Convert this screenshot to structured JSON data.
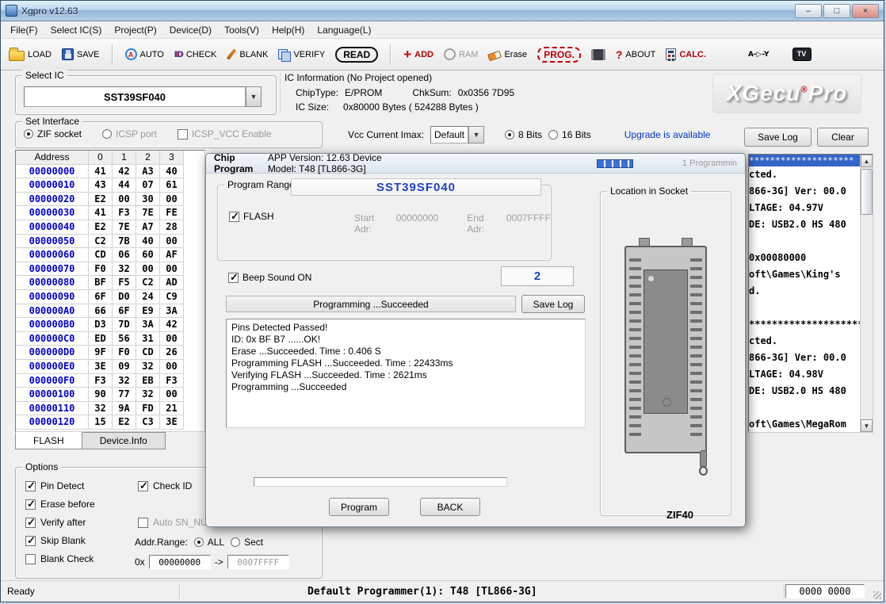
{
  "window": {
    "title": "Xgpro v12.63"
  },
  "status": {
    "ready": "Ready",
    "center": "Default Programmer(1): T48 [TL866-3G]",
    "counter": "0000 0000"
  },
  "menu": {
    "items": [
      "File(F)",
      "Select IC(S)",
      "Project(P)",
      "Device(D)",
      "Tools(V)",
      "Help(H)",
      "Language(L)"
    ]
  },
  "toolbar": {
    "items": [
      {
        "id": "load",
        "label": "LOAD"
      },
      {
        "id": "save",
        "label": "SAVE"
      },
      {
        "id": "auto",
        "label": "AUTO",
        "glyph": "A"
      },
      {
        "id": "check",
        "label": "CHECK",
        "glyph": "ID"
      },
      {
        "id": "blank",
        "label": "BLANK"
      },
      {
        "id": "verify",
        "label": "VERIFY"
      },
      {
        "id": "read",
        "label": "READ"
      },
      {
        "id": "add",
        "label": "ADD",
        "glyph": "+"
      },
      {
        "id": "ram",
        "label": "RAM"
      },
      {
        "id": "erase",
        "label": "Erase"
      },
      {
        "id": "prog",
        "label": "PROG."
      },
      {
        "id": "chip",
        "label": ""
      },
      {
        "id": "about",
        "label": "ABOUT",
        "glyph": "?"
      },
      {
        "id": "calc",
        "label": "CALC."
      },
      {
        "id": "logic",
        "label": "A-▷-Y"
      },
      {
        "id": "tv",
        "label": "TV"
      }
    ]
  },
  "select_ic": {
    "title": "Select IC",
    "value": "SST39SF040"
  },
  "ic_info": {
    "title": "IC Information (No Project opened)",
    "chip_type_label": "ChipType:",
    "chip_type": "E/PROM",
    "chksum_label": "ChkSum:",
    "chksum": "0x0356 7D95",
    "size_label": "IC Size:",
    "size": "0x80000 Bytes ( 524288 Bytes )"
  },
  "brand": {
    "text": "XGecu",
    "reg": "®",
    "pro": "Pro"
  },
  "interface": {
    "title": "Set Interface",
    "zif": "ZIF socket",
    "zif_selected": true,
    "icsp": "ICSP port",
    "icsp_selected": false,
    "vcc_enable": "ICSP_VCC Enable",
    "vcc_checked": false
  },
  "vcc": {
    "label": "Vcc Current Imax:",
    "value": "Default",
    "bits8": "8 Bits",
    "bits8_selected": true,
    "bits16": "16 Bits",
    "bits16_selected": false,
    "upgrade": "Upgrade is available",
    "save_log": "Save Log",
    "clear": "Clear"
  },
  "hex": {
    "address_header": "Address",
    "col_headers": [
      "0",
      "1",
      "2",
      "3"
    ],
    "rows": [
      {
        "addr": "00000000",
        "bytes": [
          "41",
          "42",
          "A3",
          "40"
        ]
      },
      {
        "addr": "00000010",
        "bytes": [
          "43",
          "44",
          "07",
          "61"
        ]
      },
      {
        "addr": "00000020",
        "bytes": [
          "E2",
          "00",
          "30",
          "00"
        ]
      },
      {
        "addr": "00000030",
        "bytes": [
          "41",
          "F3",
          "7E",
          "FE"
        ]
      },
      {
        "addr": "00000040",
        "bytes": [
          "E2",
          "7E",
          "A7",
          "28"
        ]
      },
      {
        "addr": "00000050",
        "bytes": [
          "C2",
          "7B",
          "40",
          "00"
        ]
      },
      {
        "addr": "00000060",
        "bytes": [
          "CD",
          "06",
          "60",
          "AF"
        ]
      },
      {
        "addr": "00000070",
        "bytes": [
          "F0",
          "32",
          "00",
          "00"
        ]
      },
      {
        "addr": "00000080",
        "bytes": [
          "BF",
          "F5",
          "C2",
          "AD"
        ]
      },
      {
        "addr": "00000090",
        "bytes": [
          "6F",
          "D0",
          "24",
          "C9"
        ]
      },
      {
        "addr": "000000A0",
        "bytes": [
          "66",
          "6F",
          "E9",
          "3A"
        ]
      },
      {
        "addr": "000000B0",
        "bytes": [
          "D3",
          "7D",
          "3A",
          "42"
        ]
      },
      {
        "addr": "000000C0",
        "bytes": [
          "ED",
          "56",
          "31",
          "00"
        ]
      },
      {
        "addr": "000000D0",
        "bytes": [
          "9F",
          "F0",
          "CD",
          "26"
        ]
      },
      {
        "addr": "000000E0",
        "bytes": [
          "3E",
          "09",
          "32",
          "00"
        ]
      },
      {
        "addr": "000000F0",
        "bytes": [
          "F3",
          "32",
          "EB",
          "F3"
        ]
      },
      {
        "addr": "00000100",
        "bytes": [
          "90",
          "77",
          "32",
          "00"
        ]
      },
      {
        "addr": "00000110",
        "bytes": [
          "32",
          "9A",
          "FD",
          "21"
        ]
      },
      {
        "addr": "00000120",
        "bytes": [
          "15",
          "E2",
          "C3",
          "3E"
        ]
      }
    ],
    "tabs": [
      "FLASH",
      "Device.Info"
    ]
  },
  "options": {
    "title": "Options",
    "checkboxes": [
      {
        "label": "Pin Detect",
        "checked": true
      },
      {
        "label": "Erase before",
        "checked": true
      },
      {
        "label": "Verify after",
        "checked": true
      },
      {
        "label": "Skip Blank",
        "checked": true
      },
      {
        "label": "Blank Check",
        "checked": false
      }
    ],
    "check_id": {
      "label": "Check ID",
      "checked": true
    },
    "auto_sn": {
      "label": "Auto SN_NUM",
      "checked": false
    },
    "addr_range_label": "Addr.Range:",
    "all_label": "ALL",
    "all_selected": true,
    "sect_label": "Sect",
    "sect_selected": false,
    "hex_prefix": "0x",
    "range_start": "00000000",
    "range_arrow": "->",
    "range_end": "0007FFFF"
  },
  "dialog": {
    "title": "Chip Program",
    "version": "APP Version: 12.63 Device Model: T48 [TL866-3G]",
    "tab_hint": "1 Programmin",
    "range_title": "Program Range",
    "chip": "SST39SF040",
    "flash": "FLASH",
    "flash_checked": true,
    "start_label": "Start Adr:",
    "start": "00000000",
    "end_label": "End Adr:",
    "end": "0007FFFF",
    "beep": "Beep Sound ON",
    "beep_checked": true,
    "count": "2",
    "status": "Programming  ...Succeeded",
    "save_log": "Save Log",
    "log": [
      "Pins Detected Passed!",
      "ID: 0x BF B7 ......OK!",
      "Erase  ...Succeeded. Time : 0.406 S",
      "Programming FLASH ...Succeeded. Time : 22433ms",
      "Verifying FLASH ...Succeeded. Time : 2621ms",
      "Programming  ...Succeeded"
    ],
    "program_btn": "Program",
    "back_btn": "BACK",
    "socket_title": "Location in Socket",
    "socket_label": "ZIF40"
  },
  "side_log": {
    "header": "********************",
    "lines": [
      "cted.",
      "866-3G] Ver: 00.0",
      "LTAGE: 04.97V",
      "DE: USB2.0 HS 480",
      "",
      "0x00080000",
      "oft\\Games\\King's",
      "d.",
      "",
      "********************",
      "cted.",
      "866-3G] Ver: 00.0",
      "LTAGE: 04.98V",
      "DE: USB2.0 HS 480",
      "",
      "oft\\Games\\MegaRom"
    ]
  },
  "icons": {
    "minimize": "–",
    "maximize": "□",
    "close": "×",
    "dropdown": "▼",
    "scroll_up": "▲",
    "scroll_down": "▼"
  }
}
